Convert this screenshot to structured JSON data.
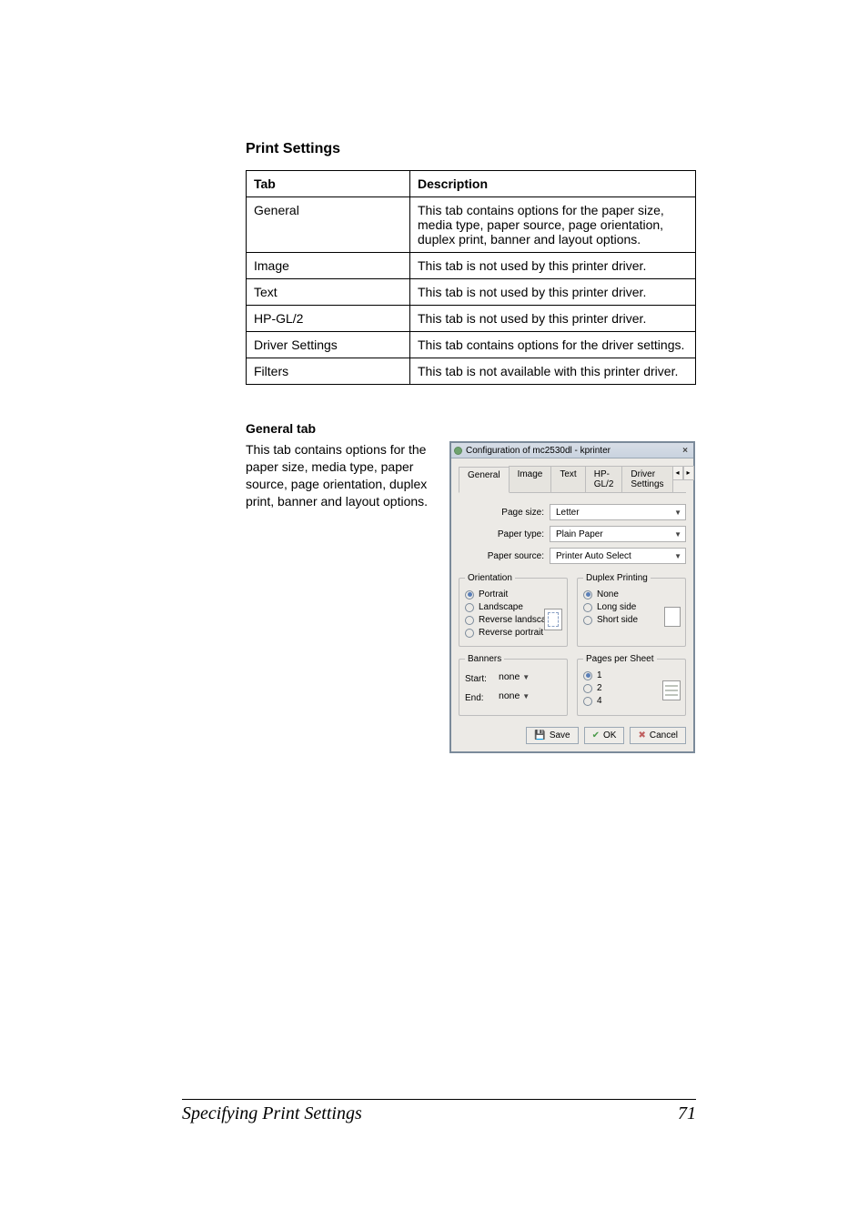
{
  "section_title": "Print Settings",
  "table": {
    "headers": {
      "col1": "Tab",
      "col2": "Description"
    },
    "rows": [
      {
        "tab": "General",
        "desc": "This tab contains options for the paper size, media type, paper source, page orientation, duplex print, banner and layout options."
      },
      {
        "tab": "Image",
        "desc": "This tab is not used by this printer driver."
      },
      {
        "tab": "Text",
        "desc": "This tab is not used by this printer driver."
      },
      {
        "tab": "HP-GL/2",
        "desc": "This tab is not used by this printer driver."
      },
      {
        "tab": "Driver Settings",
        "desc": "This tab contains options for the driver settings."
      },
      {
        "tab": "Filters",
        "desc": "This tab is not available with this printer driver."
      }
    ]
  },
  "subsection_title": "General tab",
  "subsection_text": "This tab contains options for the paper size, media type, paper source, page orientation, duplex print, banner and layout options.",
  "dialog": {
    "title": "Configuration of mc2530dl - kprinter",
    "tabs": [
      "General",
      "Image",
      "Text",
      "HP-GL/2",
      "Driver Settings"
    ],
    "page_size": {
      "label": "Page size:",
      "value": "Letter"
    },
    "paper_type": {
      "label": "Paper type:",
      "value": "Plain Paper"
    },
    "paper_source": {
      "label": "Paper source:",
      "value": "Printer Auto Select"
    },
    "orientation": {
      "legend": "Orientation",
      "options": {
        "portrait": "Portrait",
        "landscape": "Landscape",
        "rev_landscape": "Reverse landscape",
        "rev_portrait": "Reverse portrait"
      }
    },
    "duplex": {
      "legend": "Duplex Printing",
      "options": {
        "none": "None",
        "long": "Long side",
        "short": "Short side"
      }
    },
    "banners": {
      "legend": "Banners",
      "start": {
        "label": "Start:",
        "value": "none"
      },
      "end": {
        "label": "End:",
        "value": "none"
      }
    },
    "pages": {
      "legend": "Pages per Sheet",
      "options": {
        "one": "1",
        "two": "2",
        "four": "4"
      }
    },
    "buttons": {
      "save": "Save",
      "ok": "OK",
      "cancel": "Cancel"
    }
  },
  "footer": {
    "title": "Specifying Print Settings",
    "page": "71"
  }
}
